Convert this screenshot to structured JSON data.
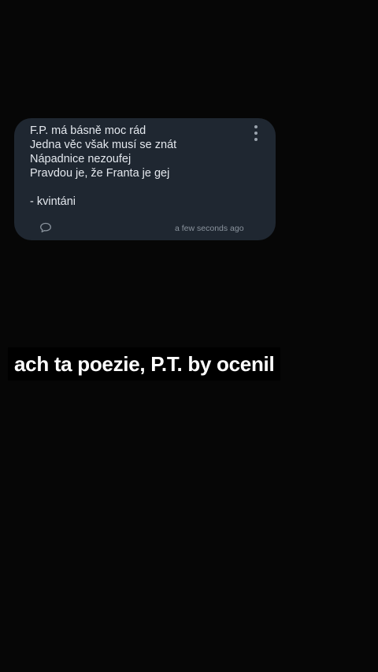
{
  "post": {
    "lines": [
      "F.P. má básně moc rád",
      "Jedna věc však musí se znát",
      "Nápadnice nezoufej",
      "Pravdou je, že Franta je gej",
      "",
      "- kvintáni"
    ],
    "timestamp": "a few seconds ago",
    "menu_icon": "more-vertical-icon",
    "comment_icon": "comment-bubble-icon"
  },
  "caption": {
    "text": "ach ta poezie, P.T. by ocenil"
  },
  "colors": {
    "background": "#060606",
    "card": "#1f2731",
    "text": "#e4e8ee",
    "muted": "#8a939d"
  }
}
